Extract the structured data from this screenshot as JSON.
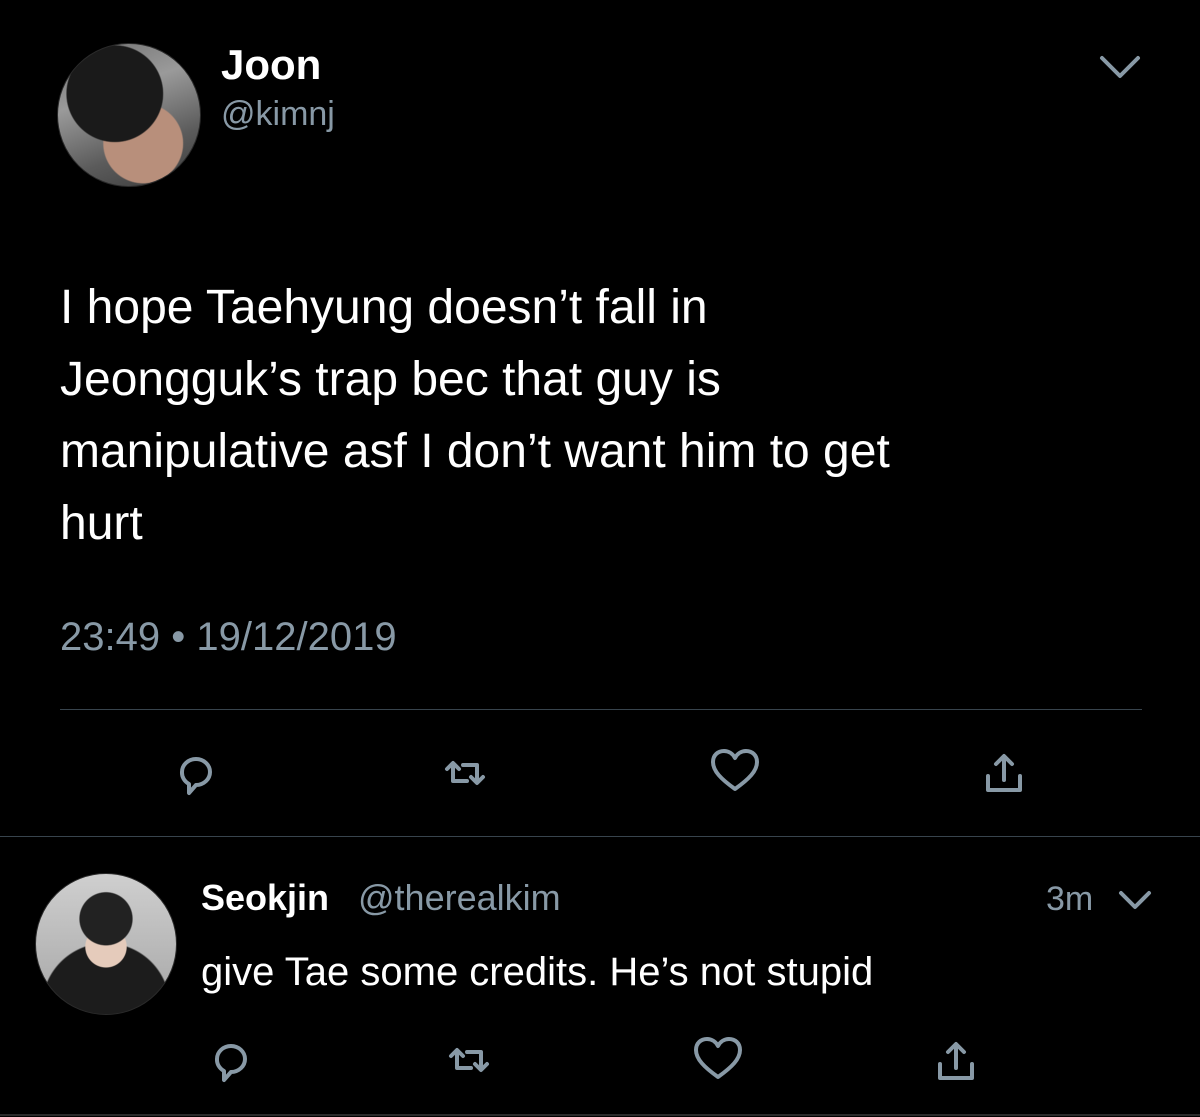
{
  "tweet": {
    "author": {
      "display_name": "Joon",
      "handle": "@kimnj",
      "avatar": "profile-photo"
    },
    "text": "I hope Taehyung doesn’t fall in\nJeongguk’s trap bec that guy is\nmanipulative asf I don’t want him to get\nhurt",
    "time": "23:49",
    "separator": "•",
    "date": "19/12/2019",
    "menu_icon": "chevron-down-icon",
    "actions": [
      "reply-icon",
      "retweet-icon",
      "like-icon",
      "share-icon"
    ]
  },
  "reply": {
    "author": {
      "display_name": "Seokjin",
      "handle": "@therealkim",
      "avatar": "profile-photo"
    },
    "time_ago": "3m",
    "text": "give Tae some credits. He’s not stupid",
    "menu_icon": "chevron-down-icon",
    "actions": [
      "reply-icon",
      "retweet-icon",
      "like-icon",
      "share-icon"
    ]
  },
  "colors": {
    "background": "#000000",
    "primary_text": "#ffffff",
    "secondary_text": "#8899a6",
    "divider": "#38444d",
    "icon": "#8899a6"
  }
}
